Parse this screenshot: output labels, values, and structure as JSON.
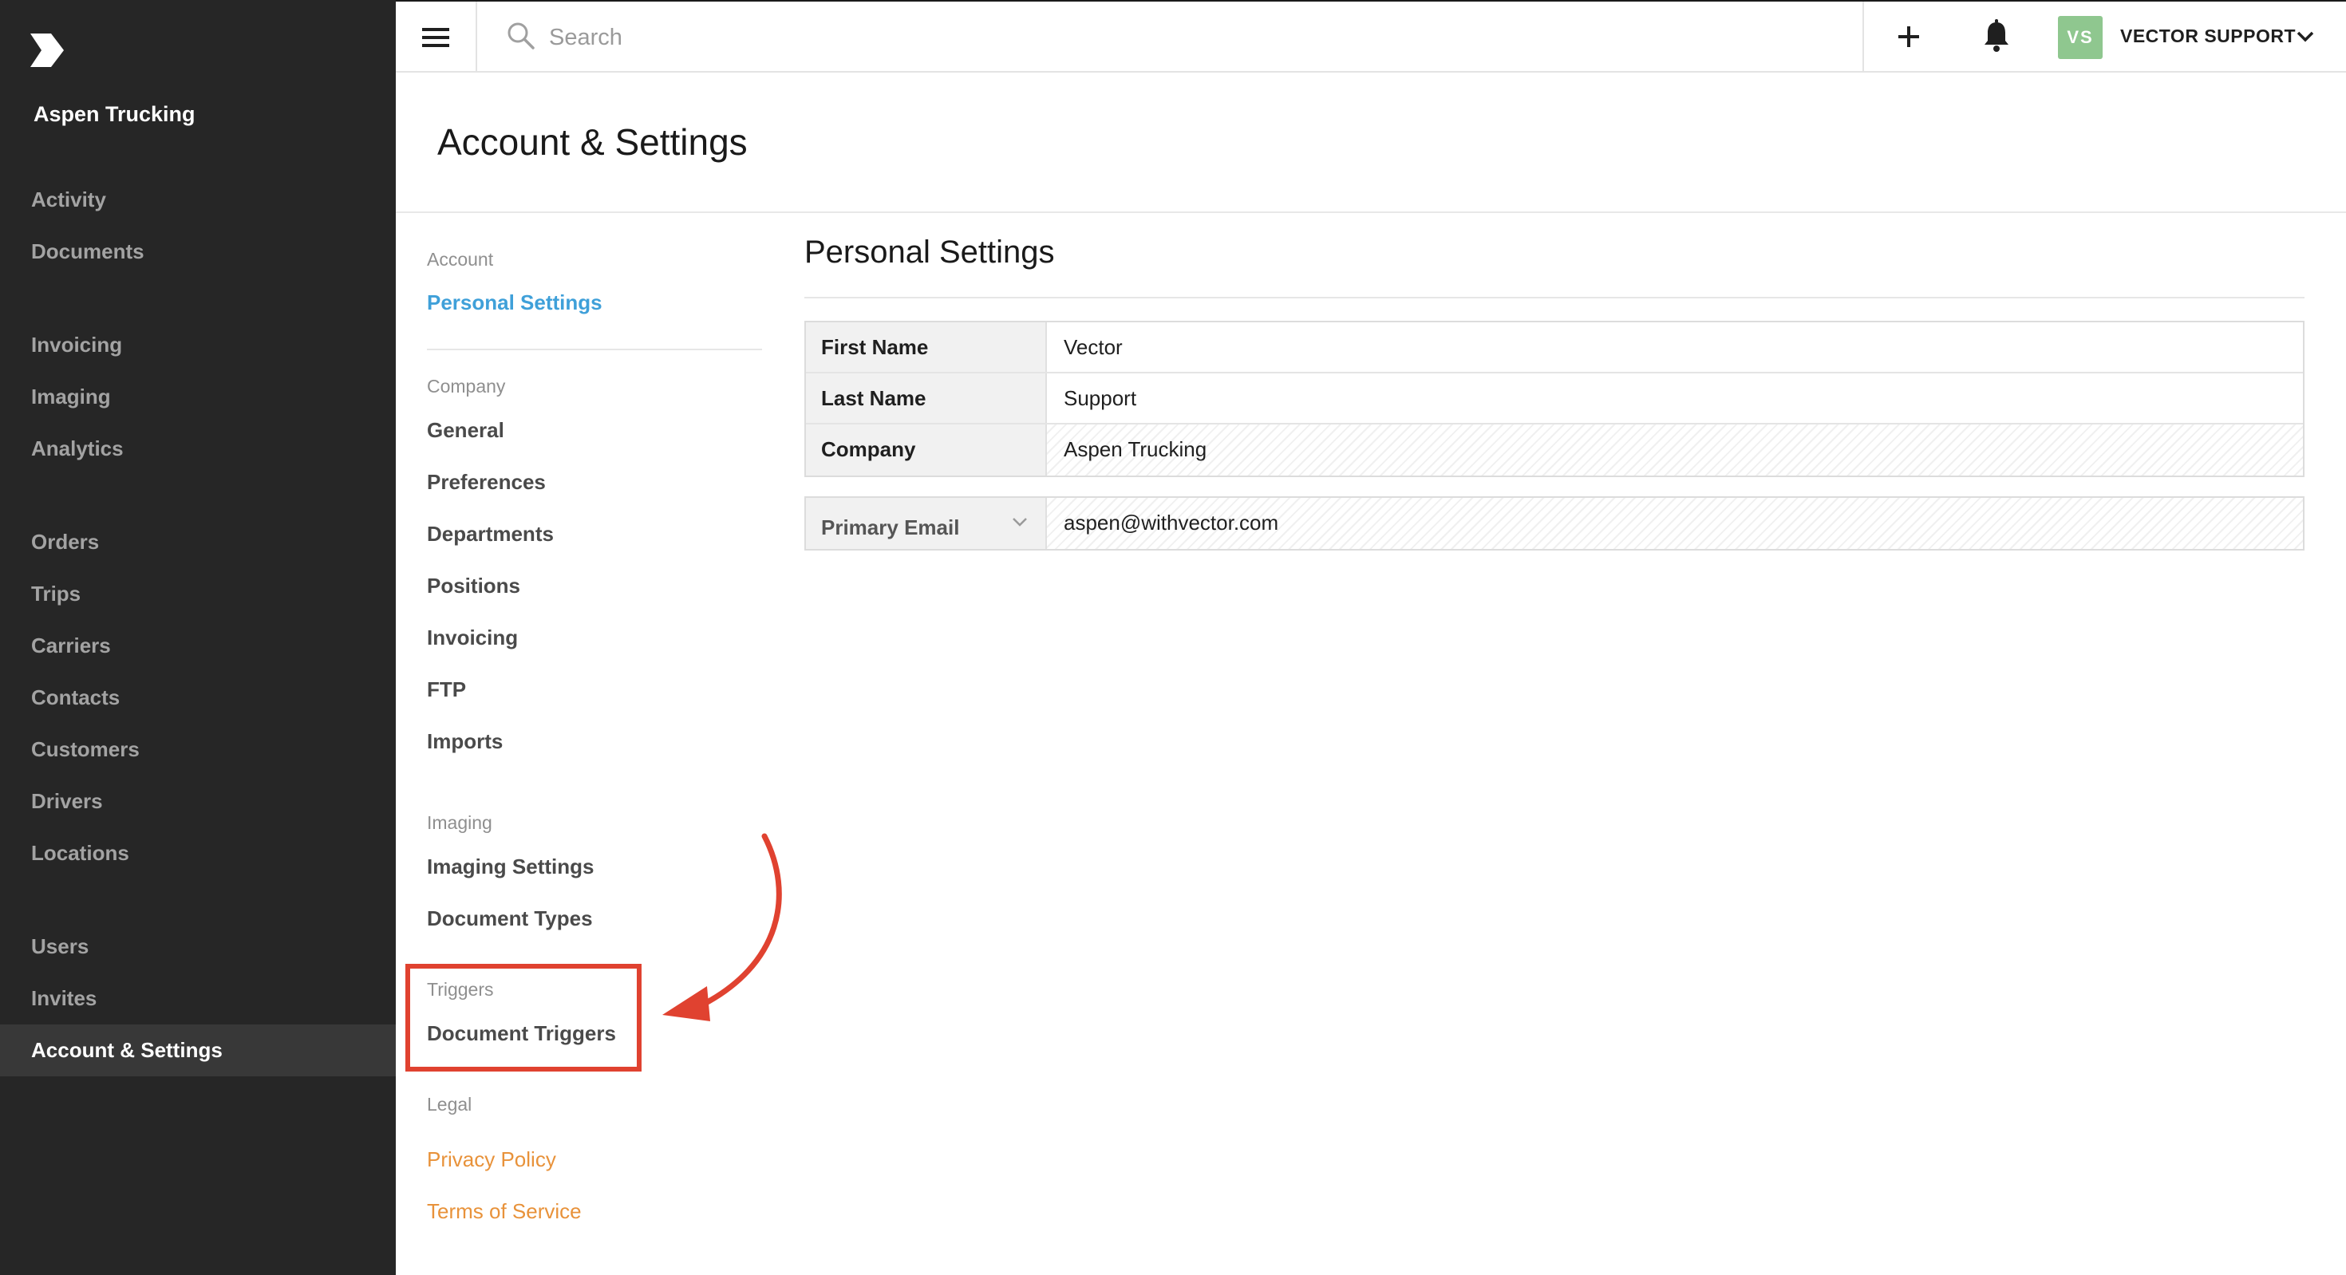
{
  "sidebar": {
    "org_name": "Aspen Trucking",
    "groups": [
      [
        "Activity",
        "Documents"
      ],
      [
        "Invoicing",
        "Imaging",
        "Analytics"
      ],
      [
        "Orders",
        "Trips",
        "Carriers",
        "Contacts",
        "Customers",
        "Drivers",
        "Locations"
      ],
      [
        "Users",
        "Invites",
        "Account & Settings"
      ]
    ],
    "active_item": "Account & Settings"
  },
  "topbar": {
    "search_placeholder": "Search",
    "avatar_initials": "VS",
    "user_name": "VECTOR SUPPORT"
  },
  "page": {
    "title": "Account & Settings"
  },
  "settings_nav": {
    "account_label": "Account",
    "personal_settings": "Personal Settings",
    "company_label": "Company",
    "general": "General",
    "preferences": "Preferences",
    "departments": "Departments",
    "positions": "Positions",
    "invoicing": "Invoicing",
    "ftp": "FTP",
    "imports": "Imports",
    "imaging_label": "Imaging",
    "imaging_settings": "Imaging Settings",
    "document_types": "Document Types",
    "triggers_label": "Triggers",
    "document_triggers": "Document Triggers",
    "legal_label": "Legal",
    "privacy_policy": "Privacy Policy",
    "terms_of_service": "Terms of Service"
  },
  "personal_settings": {
    "title": "Personal Settings",
    "first_name_label": "First Name",
    "first_name": "Vector",
    "last_name_label": "Last Name",
    "last_name": "Support",
    "company_label": "Company",
    "company": "Aspen Trucking",
    "email_label": "Primary Email",
    "email": "aspen@withvector.com"
  },
  "colors": {
    "sidebar_bg": "#262626",
    "active_link": "#3fa0d9",
    "legal_link": "#e8923a",
    "annotation": "#e04230",
    "avatar_bg": "#8fc78f"
  }
}
